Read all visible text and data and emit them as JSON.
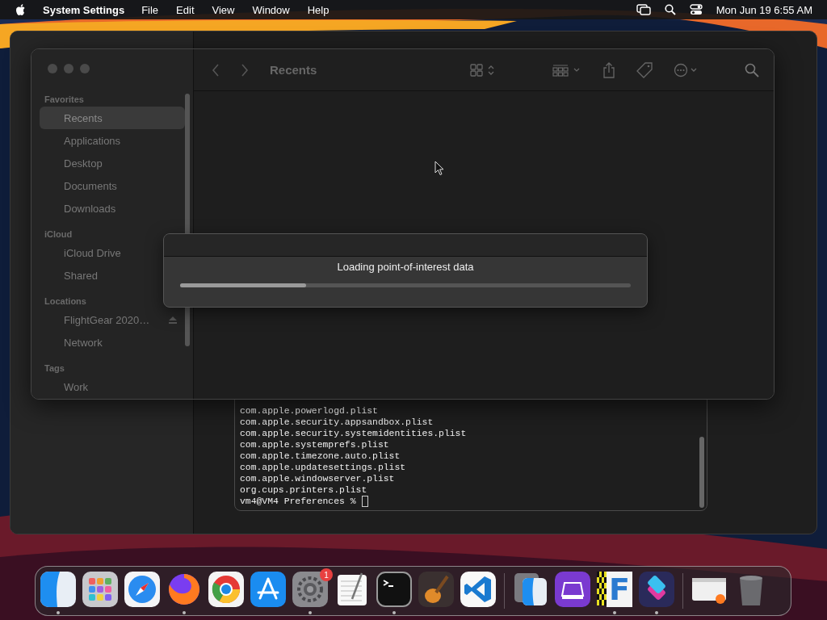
{
  "menu_bar": {
    "app": "System Settings",
    "menus": [
      "File",
      "Edit",
      "View",
      "Window",
      "Help"
    ],
    "clock": "Mon Jun 19 6:55 AM"
  },
  "finder": {
    "title": "Recents",
    "sidebar": [
      {
        "heading": "Favorites",
        "items": [
          {
            "label": "Recents",
            "selected": true,
            "ejectable": false
          },
          {
            "label": "Applications",
            "selected": false,
            "ejectable": false
          },
          {
            "label": "Desktop",
            "selected": false,
            "ejectable": false
          },
          {
            "label": "Documents",
            "selected": false,
            "ejectable": false
          },
          {
            "label": "Downloads",
            "selected": false,
            "ejectable": false
          }
        ]
      },
      {
        "heading": "iCloud",
        "items": [
          {
            "label": "iCloud Drive",
            "selected": false,
            "ejectable": false
          },
          {
            "label": "Shared",
            "selected": false,
            "ejectable": false
          }
        ]
      },
      {
        "heading": "Locations",
        "items": [
          {
            "label": "FlightGear 2020…",
            "selected": false,
            "ejectable": true
          },
          {
            "label": "Network",
            "selected": false,
            "ejectable": false
          }
        ]
      },
      {
        "heading": "Tags",
        "items": [
          {
            "label": "Work",
            "selected": false,
            "ejectable": false
          }
        ]
      }
    ]
  },
  "dialog": {
    "message": "Loading point-of-interest data",
    "level": 0.28
  },
  "terminal": {
    "lines": [
      "com.apple.powerlogd.plist",
      "com.apple.security.appsandbox.plist",
      "com.apple.security.systemidentities.plist",
      "com.apple.systemprefs.plist",
      "com.apple.timezone.auto.plist",
      "com.apple.updatesettings.plist",
      "com.apple.windowserver.plist",
      "org.cups.printers.plist"
    ],
    "prompt": "vm4@VM4 Preferences %"
  },
  "dock": [
    {
      "running": true
    },
    {
      "running": false
    },
    {
      "running": false
    },
    {
      "running": true
    },
    {
      "running": false
    },
    {
      "running": false
    },
    {
      "running": true,
      "badge": "1"
    },
    {
      "running": false
    },
    {
      "running": true
    },
    {
      "running": false
    },
    {
      "running": false
    },
    {
      "running": false
    },
    {
      "running": false
    },
    {
      "running": true,
      "glyph": "F"
    },
    {
      "running": true
    },
    {
      "running": false
    },
    {
      "running": false
    }
  ]
}
